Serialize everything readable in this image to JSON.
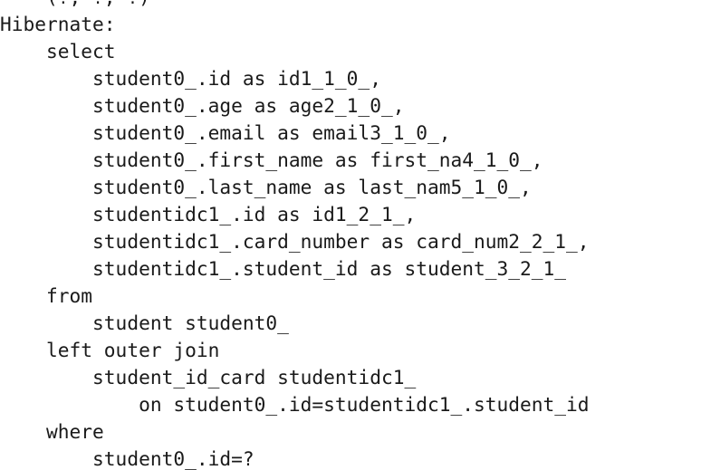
{
  "console": {
    "lines": [
      {
        "text": "    (?, ?, ?)"
      },
      {
        "text": "Hibernate: "
      },
      {
        "text": "    select"
      },
      {
        "text": "        student0_.id as id1_1_0_,"
      },
      {
        "text": "        student0_.age as age2_1_0_,"
      },
      {
        "text": "        student0_.email as email3_1_0_,"
      },
      {
        "text": "        student0_.first_name as first_na4_1_0_,"
      },
      {
        "text": "        student0_.last_name as last_nam5_1_0_,"
      },
      {
        "text": "        studentidc1_.id as id1_2_1_,"
      },
      {
        "text": "        studentidc1_.card_number as card_num2_2_1_,"
      },
      {
        "text": "        studentidc1_.student_id as student_3_2_1_ "
      },
      {
        "text": "    from"
      },
      {
        "text": "        student student0_ "
      },
      {
        "text": "    left outer join"
      },
      {
        "text": "        student_id_card studentidc1_ "
      },
      {
        "text": "            on student0_.id=studentidc1_.student_id "
      },
      {
        "text": "    where"
      },
      {
        "text": "        student0_.id=?"
      }
    ]
  }
}
